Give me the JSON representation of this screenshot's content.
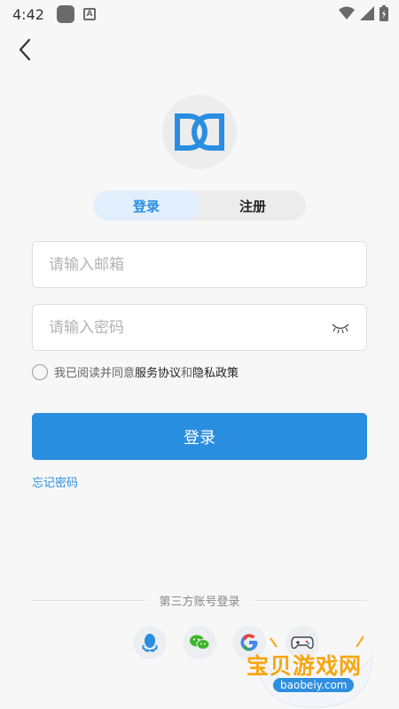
{
  "status_bar": {
    "time": "4:42"
  },
  "tabs": {
    "login": "登录",
    "register": "注册"
  },
  "email": {
    "placeholder": "请输入邮箱"
  },
  "password": {
    "placeholder": "请输入密码"
  },
  "agreement": {
    "prefix": "我已阅读并同意",
    "service": "服务协议",
    "and": "和",
    "privacy": "隐私政策"
  },
  "login_button": "登录",
  "forgot_password": "忘记密码",
  "third_party_label": "第三方账号登录",
  "watermark": {
    "text": "宝贝游戏网",
    "url": "baobeiy.com"
  },
  "colors": {
    "accent": "#2a8ee0",
    "tab_active_bg": "#e1effc"
  },
  "icons": [
    "back-arrow-icon",
    "logo-icon",
    "eye-closed-icon",
    "qq-icon",
    "wechat-icon",
    "google-icon",
    "gamepad-icon"
  ]
}
